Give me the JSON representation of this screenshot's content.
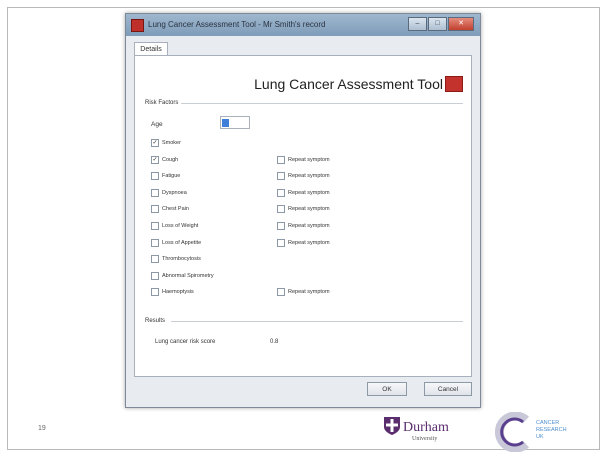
{
  "slide": {
    "number": "19"
  },
  "window": {
    "title": "Lung Cancer Assessment Tool - Mr Smith's record",
    "controls": {
      "minimize": "–",
      "maximize": "□",
      "close": "✕"
    }
  },
  "tab": {
    "label": "Details"
  },
  "tool": {
    "title": "Lung Cancer Assessment Tool"
  },
  "risk_factors": {
    "group_label": "Risk Factors",
    "age_label": "Age"
  },
  "symptoms": [
    {
      "label": "Smoker",
      "checked": true,
      "repeat_label": ""
    },
    {
      "label": "Cough",
      "checked": true,
      "repeat_label": "Repeat symptom"
    },
    {
      "label": "Fatigue",
      "checked": false,
      "repeat_label": "Repeat symptom"
    },
    {
      "label": "Dyspnoea",
      "checked": false,
      "repeat_label": "Repeat symptom"
    },
    {
      "label": "Chest Pain",
      "checked": false,
      "repeat_label": "Repeat symptom"
    },
    {
      "label": "Loss of Weight",
      "checked": false,
      "repeat_label": "Repeat symptom"
    },
    {
      "label": "Loss of Appetite",
      "checked": false,
      "repeat_label": "Repeat symptom"
    },
    {
      "label": "Thrombocytosis",
      "checked": false,
      "repeat_label": ""
    },
    {
      "label": "Abnormal Spirometry",
      "checked": false,
      "repeat_label": ""
    },
    {
      "label": "Haemoptysis",
      "checked": false,
      "repeat_label": "Repeat symptom"
    }
  ],
  "results": {
    "group_label": "Results",
    "risk_label": "Lung cancer risk score",
    "risk_value": "0.8"
  },
  "buttons": {
    "ok": "OK",
    "cancel": "Cancel"
  },
  "logos": {
    "durham": {
      "name": "Durham",
      "sub": "University",
      "color": "#5a2d6e"
    },
    "cruk": {
      "line1": "CANCER",
      "line2": "RESEARCH",
      "line3": "UK",
      "color": "#4f8fd0"
    }
  }
}
